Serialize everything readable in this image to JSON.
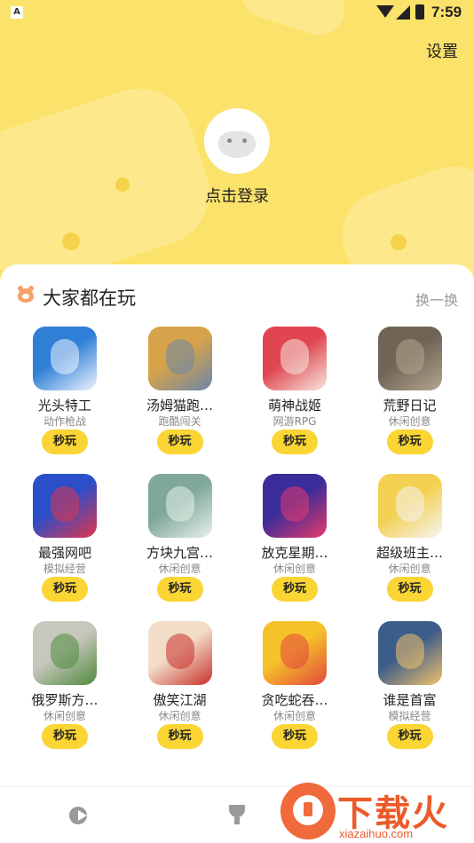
{
  "status_bar": {
    "time": "7:59",
    "app_badge": "A"
  },
  "header": {
    "settings_label": "设置",
    "login_label": "点击登录"
  },
  "section": {
    "title": "大家都在玩",
    "refresh_label": "换一换"
  },
  "play_label": "秒玩",
  "games": [
    {
      "name": "光头特工",
      "category": "动作枪战",
      "colors": [
        "#2f7fd6",
        "#f0f4ff"
      ],
      "icon": "bald-agent-game-icon"
    },
    {
      "name": "汤姆猫跑…",
      "category": "跑酷闯关",
      "colors": [
        "#d7a34a",
        "#6b86a8"
      ],
      "icon": "talking-tom-run-game-icon"
    },
    {
      "name": "萌神战姬",
      "category": "网游RPG",
      "colors": [
        "#e04550",
        "#f6e8df"
      ],
      "icon": "moe-goddess-game-icon"
    },
    {
      "name": "荒野日记",
      "category": "休闲创意",
      "colors": [
        "#6f6456",
        "#b3a58f"
      ],
      "icon": "wild-diary-game-icon"
    },
    {
      "name": "最强网吧",
      "category": "模拟经营",
      "colors": [
        "#2b4fc9",
        "#e2344a"
      ],
      "icon": "internet-cafe-game-icon"
    },
    {
      "name": "方块九宫…",
      "category": "休闲创意",
      "colors": [
        "#7fa89a",
        "#e8f0ea"
      ],
      "icon": "block-sudoku-game-icon"
    },
    {
      "name": "放克星期…",
      "category": "休闲创意",
      "colors": [
        "#3a2c9a",
        "#e83a6b"
      ],
      "icon": "friday-funkin-game-icon"
    },
    {
      "name": "超级班主…",
      "category": "休闲创意",
      "colors": [
        "#f3d050",
        "#f4f4f4"
      ],
      "icon": "super-teacher-game-icon"
    },
    {
      "name": "俄罗斯方…",
      "category": "休闲创意",
      "colors": [
        "#c8c7bd",
        "#4f8a3b"
      ],
      "icon": "tetris-game-icon"
    },
    {
      "name": "傲笑江湖",
      "category": "休闲创意",
      "colors": [
        "#f2dec8",
        "#c9302c"
      ],
      "icon": "wuxia-game-icon"
    },
    {
      "name": "贪吃蛇吞…",
      "category": "休闲创意",
      "colors": [
        "#f6c22a",
        "#e2463c"
      ],
      "icon": "snake-tower-game-icon"
    },
    {
      "name": "谁是首富",
      "category": "模拟经营",
      "colors": [
        "#3c5c8a",
        "#f2c26a"
      ],
      "icon": "richest-man-game-icon"
    }
  ],
  "watermark": {
    "text": "下载火",
    "url": "xiazaihuo.com"
  },
  "colors": {
    "hero": "#fbe26a",
    "play_button": "#fad534",
    "accent": "#ec5a2a"
  }
}
